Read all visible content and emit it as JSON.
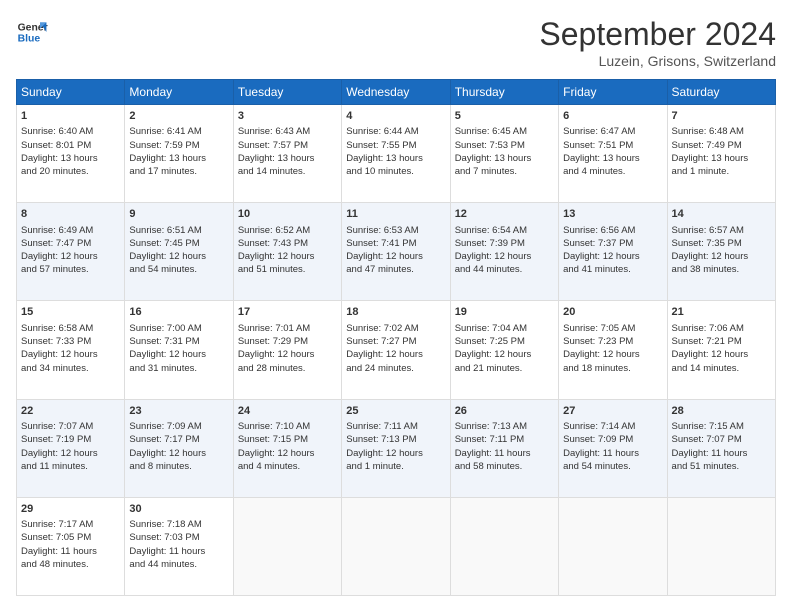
{
  "header": {
    "logo_line1": "General",
    "logo_line2": "Blue",
    "month_title": "September 2024",
    "location": "Luzein, Grisons, Switzerland"
  },
  "weekdays": [
    "Sunday",
    "Monday",
    "Tuesday",
    "Wednesday",
    "Thursday",
    "Friday",
    "Saturday"
  ],
  "weeks": [
    [
      {
        "day": "1",
        "lines": [
          "Sunrise: 6:40 AM",
          "Sunset: 8:01 PM",
          "Daylight: 13 hours",
          "and 20 minutes."
        ]
      },
      {
        "day": "2",
        "lines": [
          "Sunrise: 6:41 AM",
          "Sunset: 7:59 PM",
          "Daylight: 13 hours",
          "and 17 minutes."
        ]
      },
      {
        "day": "3",
        "lines": [
          "Sunrise: 6:43 AM",
          "Sunset: 7:57 PM",
          "Daylight: 13 hours",
          "and 14 minutes."
        ]
      },
      {
        "day": "4",
        "lines": [
          "Sunrise: 6:44 AM",
          "Sunset: 7:55 PM",
          "Daylight: 13 hours",
          "and 10 minutes."
        ]
      },
      {
        "day": "5",
        "lines": [
          "Sunrise: 6:45 AM",
          "Sunset: 7:53 PM",
          "Daylight: 13 hours",
          "and 7 minutes."
        ]
      },
      {
        "day": "6",
        "lines": [
          "Sunrise: 6:47 AM",
          "Sunset: 7:51 PM",
          "Daylight: 13 hours",
          "and 4 minutes."
        ]
      },
      {
        "day": "7",
        "lines": [
          "Sunrise: 6:48 AM",
          "Sunset: 7:49 PM",
          "Daylight: 13 hours",
          "and 1 minute."
        ]
      }
    ],
    [
      {
        "day": "8",
        "lines": [
          "Sunrise: 6:49 AM",
          "Sunset: 7:47 PM",
          "Daylight: 12 hours",
          "and 57 minutes."
        ]
      },
      {
        "day": "9",
        "lines": [
          "Sunrise: 6:51 AM",
          "Sunset: 7:45 PM",
          "Daylight: 12 hours",
          "and 54 minutes."
        ]
      },
      {
        "day": "10",
        "lines": [
          "Sunrise: 6:52 AM",
          "Sunset: 7:43 PM",
          "Daylight: 12 hours",
          "and 51 minutes."
        ]
      },
      {
        "day": "11",
        "lines": [
          "Sunrise: 6:53 AM",
          "Sunset: 7:41 PM",
          "Daylight: 12 hours",
          "and 47 minutes."
        ]
      },
      {
        "day": "12",
        "lines": [
          "Sunrise: 6:54 AM",
          "Sunset: 7:39 PM",
          "Daylight: 12 hours",
          "and 44 minutes."
        ]
      },
      {
        "day": "13",
        "lines": [
          "Sunrise: 6:56 AM",
          "Sunset: 7:37 PM",
          "Daylight: 12 hours",
          "and 41 minutes."
        ]
      },
      {
        "day": "14",
        "lines": [
          "Sunrise: 6:57 AM",
          "Sunset: 7:35 PM",
          "Daylight: 12 hours",
          "and 38 minutes."
        ]
      }
    ],
    [
      {
        "day": "15",
        "lines": [
          "Sunrise: 6:58 AM",
          "Sunset: 7:33 PM",
          "Daylight: 12 hours",
          "and 34 minutes."
        ]
      },
      {
        "day": "16",
        "lines": [
          "Sunrise: 7:00 AM",
          "Sunset: 7:31 PM",
          "Daylight: 12 hours",
          "and 31 minutes."
        ]
      },
      {
        "day": "17",
        "lines": [
          "Sunrise: 7:01 AM",
          "Sunset: 7:29 PM",
          "Daylight: 12 hours",
          "and 28 minutes."
        ]
      },
      {
        "day": "18",
        "lines": [
          "Sunrise: 7:02 AM",
          "Sunset: 7:27 PM",
          "Daylight: 12 hours",
          "and 24 minutes."
        ]
      },
      {
        "day": "19",
        "lines": [
          "Sunrise: 7:04 AM",
          "Sunset: 7:25 PM",
          "Daylight: 12 hours",
          "and 21 minutes."
        ]
      },
      {
        "day": "20",
        "lines": [
          "Sunrise: 7:05 AM",
          "Sunset: 7:23 PM",
          "Daylight: 12 hours",
          "and 18 minutes."
        ]
      },
      {
        "day": "21",
        "lines": [
          "Sunrise: 7:06 AM",
          "Sunset: 7:21 PM",
          "Daylight: 12 hours",
          "and 14 minutes."
        ]
      }
    ],
    [
      {
        "day": "22",
        "lines": [
          "Sunrise: 7:07 AM",
          "Sunset: 7:19 PM",
          "Daylight: 12 hours",
          "and 11 minutes."
        ]
      },
      {
        "day": "23",
        "lines": [
          "Sunrise: 7:09 AM",
          "Sunset: 7:17 PM",
          "Daylight: 12 hours",
          "and 8 minutes."
        ]
      },
      {
        "day": "24",
        "lines": [
          "Sunrise: 7:10 AM",
          "Sunset: 7:15 PM",
          "Daylight: 12 hours",
          "and 4 minutes."
        ]
      },
      {
        "day": "25",
        "lines": [
          "Sunrise: 7:11 AM",
          "Sunset: 7:13 PM",
          "Daylight: 12 hours",
          "and 1 minute."
        ]
      },
      {
        "day": "26",
        "lines": [
          "Sunrise: 7:13 AM",
          "Sunset: 7:11 PM",
          "Daylight: 11 hours",
          "and 58 minutes."
        ]
      },
      {
        "day": "27",
        "lines": [
          "Sunrise: 7:14 AM",
          "Sunset: 7:09 PM",
          "Daylight: 11 hours",
          "and 54 minutes."
        ]
      },
      {
        "day": "28",
        "lines": [
          "Sunrise: 7:15 AM",
          "Sunset: 7:07 PM",
          "Daylight: 11 hours",
          "and 51 minutes."
        ]
      }
    ],
    [
      {
        "day": "29",
        "lines": [
          "Sunrise: 7:17 AM",
          "Sunset: 7:05 PM",
          "Daylight: 11 hours",
          "and 48 minutes."
        ]
      },
      {
        "day": "30",
        "lines": [
          "Sunrise: 7:18 AM",
          "Sunset: 7:03 PM",
          "Daylight: 11 hours",
          "and 44 minutes."
        ]
      },
      {
        "day": "",
        "lines": []
      },
      {
        "day": "",
        "lines": []
      },
      {
        "day": "",
        "lines": []
      },
      {
        "day": "",
        "lines": []
      },
      {
        "day": "",
        "lines": []
      }
    ]
  ]
}
